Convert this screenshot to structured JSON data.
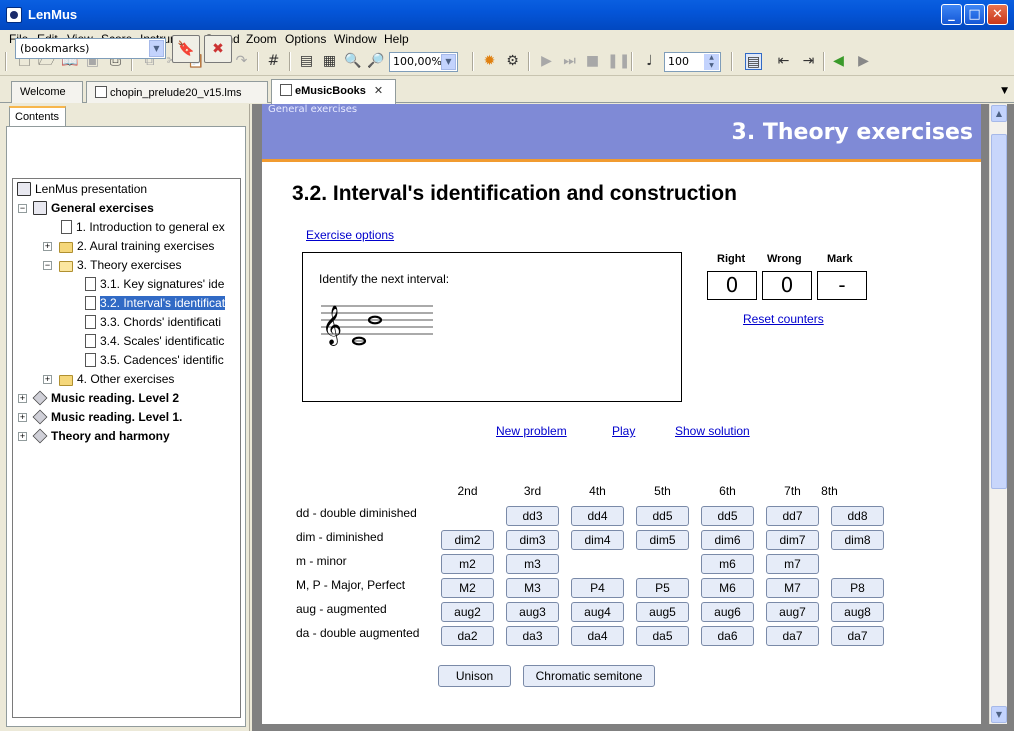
{
  "window": {
    "title": "LenMus"
  },
  "menu": [
    "File",
    "Edit",
    "View",
    "Score",
    "Instrument",
    "Sound",
    "Zoom",
    "Options",
    "Window",
    "Help"
  ],
  "toolbar": {
    "zoom": "100,00%",
    "spin_value": "100"
  },
  "doc_tabs": [
    "Welcome",
    "chopin_prelude20_v15.lms",
    "eMusicBooks"
  ],
  "left_panel": {
    "tab": "Contents",
    "bookmarks_value": "(bookmarks)",
    "tree": [
      "LenMus presentation",
      "General exercises",
      "1. Introduction to general ex",
      "2. Aural training exercises",
      "3. Theory exercises",
      "3.1. Key signatures' ide",
      "3.2. Interval's identificat",
      "3.3. Chords' identificati",
      "3.4. Scales' identificatic",
      "3.5. Cadences' identific",
      "4. Other exercises",
      "Music reading. Level 2",
      "Music reading. Level 1.",
      "Theory and harmony"
    ]
  },
  "page": {
    "breadcrumb": "General exercises",
    "section_title": "3. Theory exercises",
    "heading": "3.2. Interval's identification and construction",
    "exercise_options": "Exercise options",
    "prompt": "Identify the next interval:",
    "counters": {
      "right_label": "Right",
      "wrong_label": "Wrong",
      "mark_label": "Mark",
      "right": "0",
      "wrong": "0",
      "mark": "-",
      "reset": "Reset counters"
    },
    "actions": {
      "new_problem": "New problem",
      "play": "Play",
      "show_solution": "Show solution"
    },
    "columns": [
      "2nd",
      "3rd",
      "4th",
      "5th",
      "6th",
      "7th",
      "8th"
    ],
    "row_labels": [
      "dd - double diminished",
      "dim - diminished",
      "m - minor",
      "M, P - Major, Perfect",
      "aug - augmented",
      "da - double augmented"
    ],
    "grid": [
      [
        "",
        "dd3",
        "dd4",
        "dd5",
        "dd5",
        "dd7",
        "dd8"
      ],
      [
        "dim2",
        "dim3",
        "dim4",
        "dim5",
        "dim6",
        "dim7",
        "dim8"
      ],
      [
        "m2",
        "m3",
        "",
        "",
        "m6",
        "m7",
        ""
      ],
      [
        "M2",
        "M3",
        "P4",
        "P5",
        "M6",
        "M7",
        "P8"
      ],
      [
        "aug2",
        "aug3",
        "aug4",
        "aug5",
        "aug6",
        "aug7",
        "aug8"
      ],
      [
        "da2",
        "da3",
        "da4",
        "da5",
        "da6",
        "da7",
        "da7"
      ]
    ],
    "unison": "Unison",
    "chromatic": "Chromatic semitone"
  }
}
